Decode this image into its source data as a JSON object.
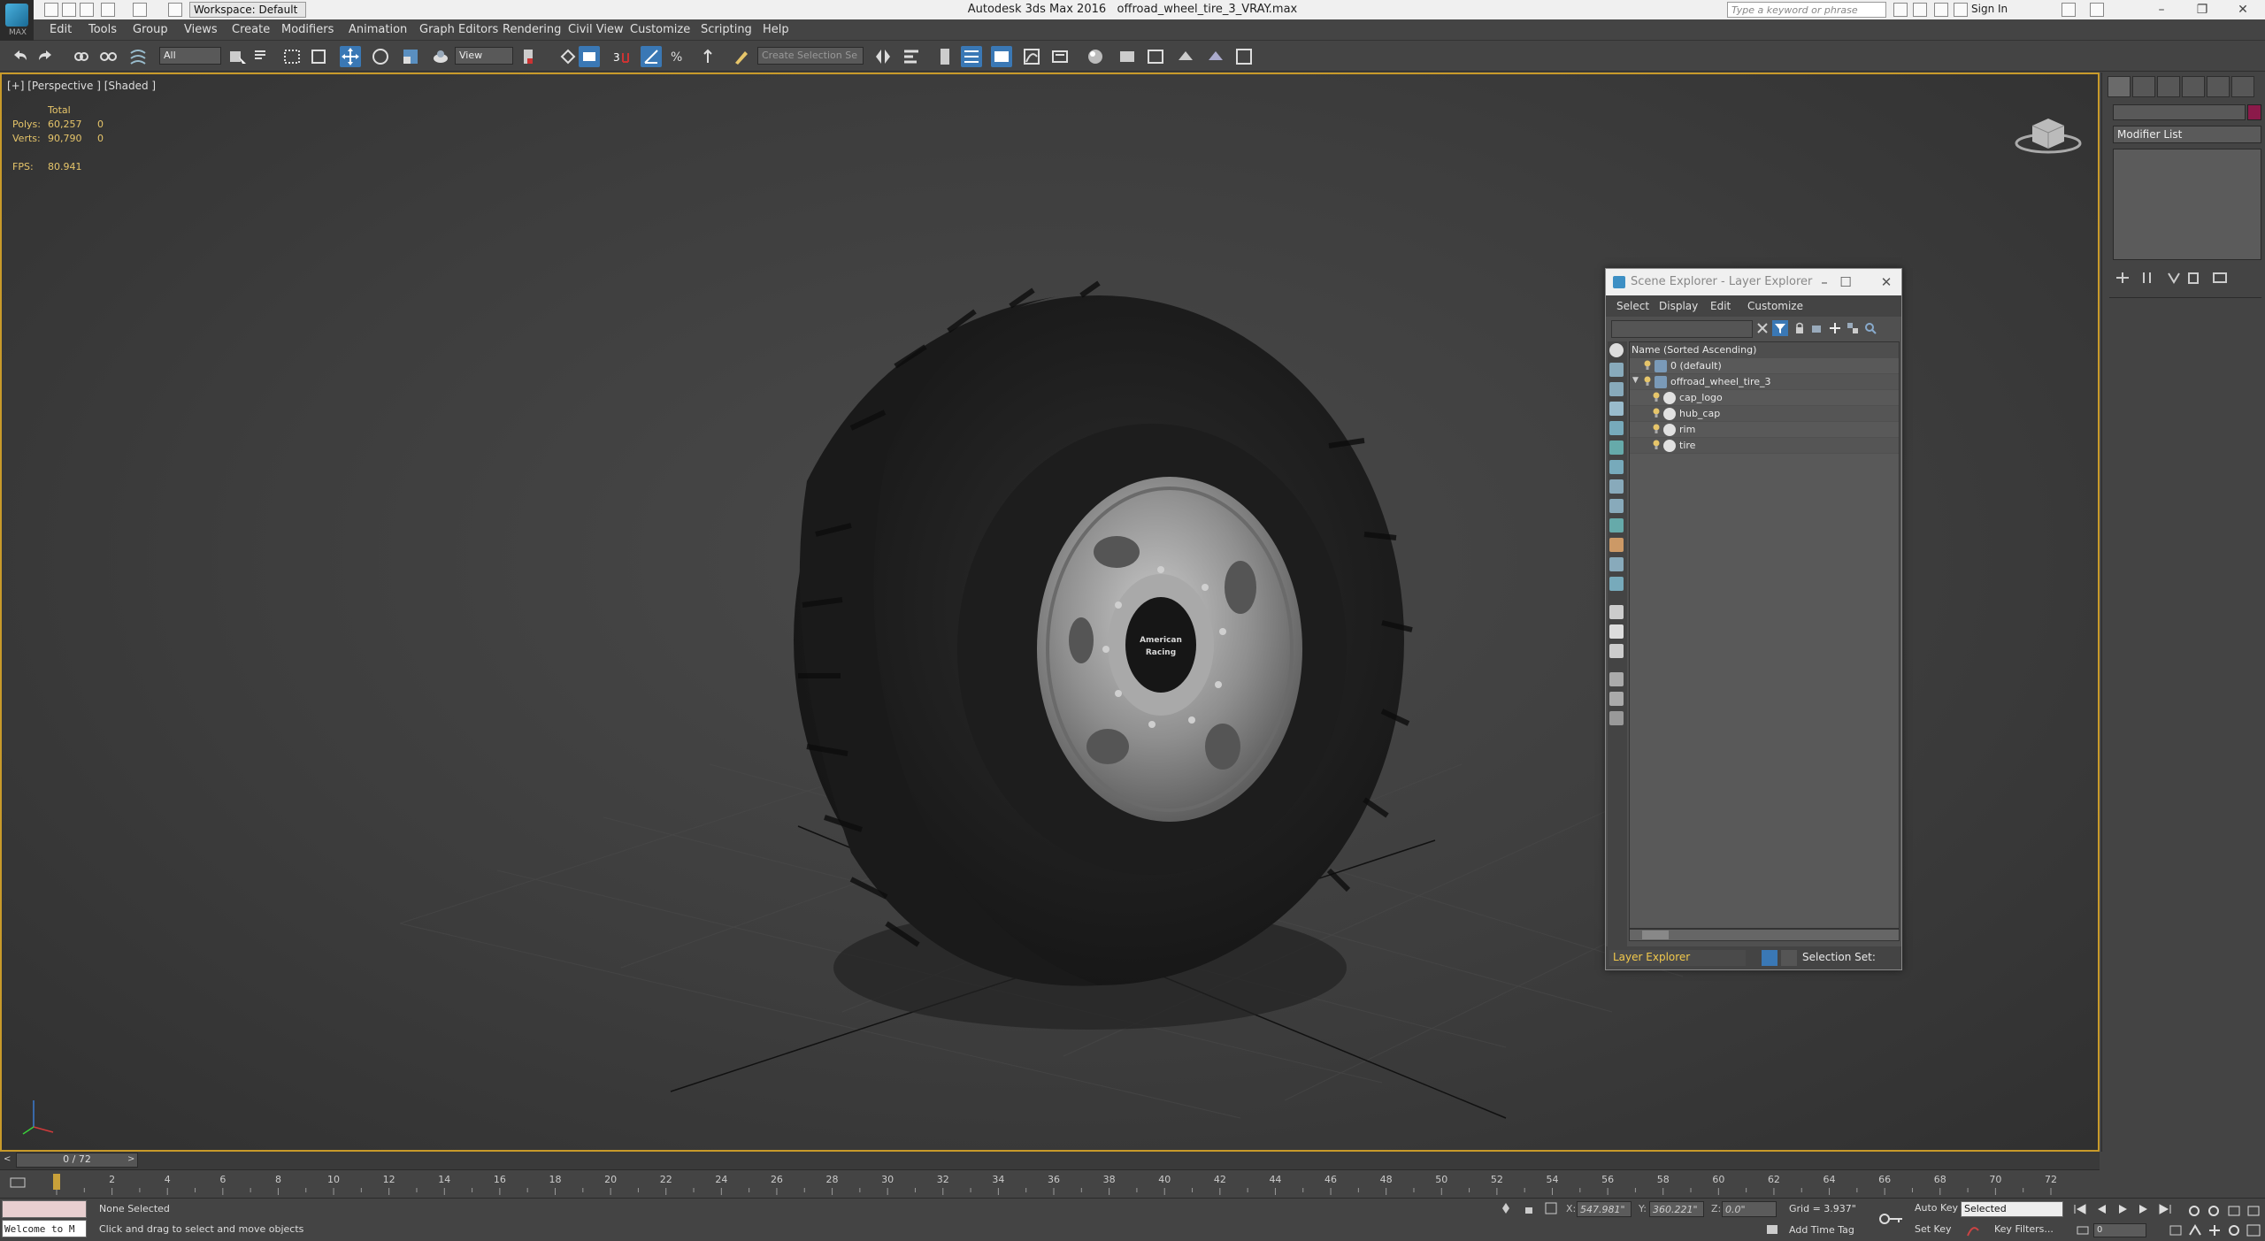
{
  "app": {
    "title": "Autodesk 3ds Max 2016",
    "file": "offroad_wheel_tire_3_VRAY.max",
    "workspace": "Workspace: Default",
    "search_placeholder": "Type a keyword or phrase",
    "sign_in": "Sign In",
    "logo_text": "MAX"
  },
  "menu": [
    "Edit",
    "Tools",
    "Group",
    "Views",
    "Create",
    "Modifiers",
    "Animation",
    "Graph Editors",
    "Rendering",
    "Civil View",
    "Customize",
    "Scripting",
    "Help"
  ],
  "toolbar": {
    "selection_filter": "All",
    "ref_coord": "View",
    "selection_set": "Create Selection Se"
  },
  "viewport": {
    "label": "[+] [Perspective ] [Shaded ]",
    "stats": {
      "header": "Total",
      "polys_label": "Polys:",
      "polys_total": "60,257",
      "polys_sel": "0",
      "verts_label": "Verts:",
      "verts_total": "90,790",
      "verts_sel": "0",
      "fps_label": "FPS:",
      "fps_value": "80.941"
    },
    "logo_text_1": "American",
    "logo_text_2": "Racing"
  },
  "command_panel": {
    "modifier_list": "Modifier List"
  },
  "scene_explorer": {
    "title": "Scene Explorer - Layer Explorer",
    "menu": [
      "Select",
      "Display",
      "Edit",
      "Customize"
    ],
    "column_header": "Name (Sorted Ascending)",
    "rows": [
      {
        "name": "0 (default)",
        "type": "layer"
      },
      {
        "name": "offroad_wheel_tire_3",
        "type": "layer"
      },
      {
        "name": "cap_logo",
        "type": "object"
      },
      {
        "name": "hub_cap",
        "type": "object"
      },
      {
        "name": "rim",
        "type": "object"
      },
      {
        "name": "tire",
        "type": "object"
      }
    ],
    "explorer_type": "Layer Explorer",
    "selection_set_label": "Selection Set:"
  },
  "timeline": {
    "frame": "0 / 72",
    "ticks": [
      "0",
      "2",
      "4",
      "6",
      "8",
      "10",
      "12",
      "14",
      "16",
      "18",
      "20",
      "22",
      "24",
      "26",
      "28",
      "30",
      "32",
      "34",
      "36",
      "38",
      "40",
      "42",
      "44",
      "46",
      "48",
      "50",
      "52",
      "54",
      "56",
      "58",
      "60",
      "62",
      "64",
      "66",
      "68",
      "70",
      "72"
    ]
  },
  "status": {
    "maxscript": "Welcome to M",
    "selection": "None Selected",
    "prompt": "Click and drag to select and move objects",
    "x_label": "X:",
    "x_value": "547.981\"",
    "y_label": "Y:",
    "y_value": "360.221\"",
    "z_label": "Z:",
    "z_value": "0.0\"",
    "grid": "Grid = 3.937\"",
    "add_time_tag": "Add Time Tag",
    "auto_key": "Auto Key",
    "set_key": "Set Key",
    "selected": "Selected",
    "key_filters": "Key Filters...",
    "frame_field": "0"
  },
  "colors": {
    "viewport_border": "#c89a2a",
    "stats_text": "#e6c56a",
    "layer_explorer_label": "#f2c94c",
    "object_color": "#8b1a4a"
  }
}
